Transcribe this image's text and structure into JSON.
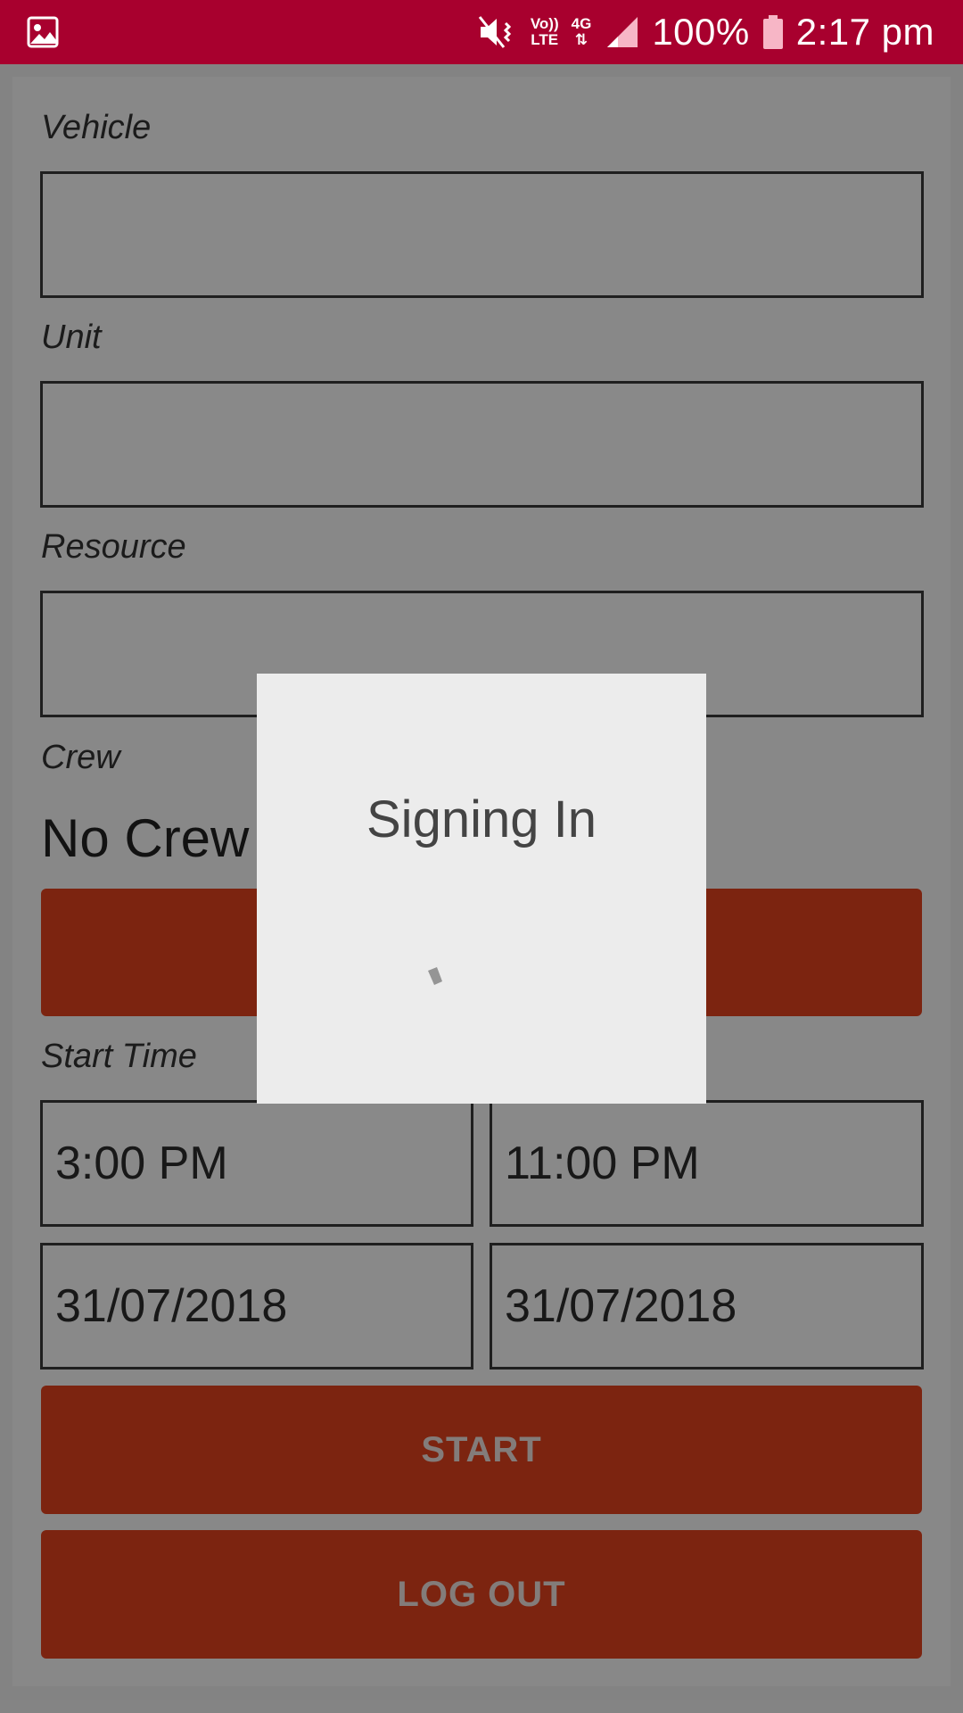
{
  "status_bar": {
    "gallery_icon": "image-icon",
    "mute_icon": "mute-vibrate-icon",
    "volte_line1": "Vo))",
    "volte_line2": "LTE",
    "network_type": "4G",
    "signal_icon": "signal-icon",
    "battery_percent": "100%",
    "battery_icon": "battery-icon",
    "time": "2:17 pm",
    "bar_color": "#a8002e"
  },
  "form": {
    "vehicle_label": "Vehicle",
    "vehicle_value": "",
    "unit_label": "Unit",
    "unit_value": "",
    "resource_label": "Resource",
    "resource_value": "",
    "crew_label": "Crew",
    "crew_value": "No Crew",
    "crew_button_label": "",
    "start_time_label": "Start Time",
    "start_time": "3:00 PM",
    "end_time": "11:00 PM",
    "start_date": "31/07/2018",
    "end_date": "31/07/2018",
    "start_button": "START",
    "logout_button": "LOG OUT",
    "accent_color": "#e5441f"
  },
  "dialog": {
    "title": "Signing In",
    "spinner_icon": "loading-spinner-icon"
  }
}
